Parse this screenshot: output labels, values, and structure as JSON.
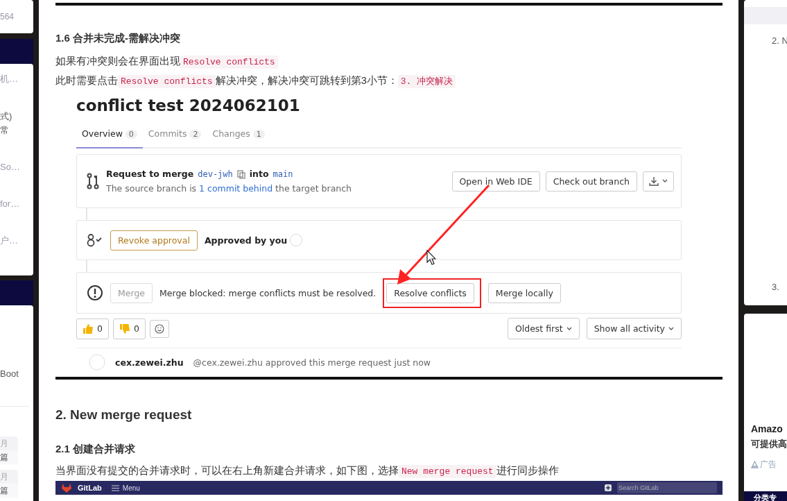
{
  "left_sidebar": {
    "top_card_text": "564",
    "recent_items": [
      "机…",
      "式)",
      "常",
      "So…",
      "for…",
      "户…"
    ],
    "second_card_items": [
      "Boot"
    ],
    "archive_chips": [
      {
        "month": "月",
        "count": "篇"
      },
      {
        "month": "月",
        "count": "篇"
      }
    ]
  },
  "article": {
    "section_heading": "1.6 合并未完成-需解决冲突",
    "paragraphs": [
      [
        {
          "kind": "text",
          "text": "如果有冲突则会在界面出现"
        },
        {
          "kind": "code",
          "text": "Resolve conflicts"
        }
      ],
      [
        {
          "kind": "text",
          "text": "此时需要点击"
        },
        {
          "kind": "code",
          "text": "Resolve conflicts"
        },
        {
          "kind": "text",
          "text": "解决冲突，解决冲突可跳转到第3小节："
        },
        {
          "kind": "code",
          "text": "3. 冲突解决"
        }
      ]
    ],
    "screenshot": {
      "title": "conflict test 2024062101",
      "tabs": [
        {
          "label": "Overview",
          "count": "0",
          "selected": true
        },
        {
          "label": "Commits",
          "count": "2",
          "selected": false
        },
        {
          "label": "Changes",
          "count": "1",
          "selected": false
        }
      ],
      "merge_info": {
        "prefix": "Request to merge",
        "source_branch": "dev-jwh",
        "joiner": "into",
        "target_branch": "main",
        "status_before": "The source branch is ",
        "status_link": "1 commit behind",
        "status_after": " the target branch",
        "buttons": [
          "Open in Web IDE",
          "Check out branch"
        ]
      },
      "approval": {
        "button": "Revoke approval",
        "status": "Approved by you"
      },
      "merge_widget": {
        "merge_button": {
          "label": "Merge",
          "disabled": true
        },
        "message": "Merge blocked: merge conflicts must be resolved.",
        "actions": [
          {
            "label": "Resolve conflicts",
            "highlighted": true
          },
          {
            "label": "Merge locally",
            "highlighted": false
          }
        ]
      },
      "reactions": [
        {
          "kind": "thumbs_up",
          "count": "0"
        },
        {
          "kind": "thumbs_down",
          "count": "0"
        }
      ],
      "sort_buttons": [
        "Oldest first",
        "Show all activity"
      ],
      "activity": {
        "author": "cex.zewei.zhu",
        "text": "@cex.zewei.zhu approved this merge request just now"
      }
    },
    "heading_2": "2. New merge request",
    "heading_3": "2.1 创建合并请求",
    "paragraph_3": [
      {
        "kind": "text",
        "text": "当界面没有提交的合并请求时，可以在右上角新建合并请求，如下图，选择"
      },
      {
        "kind": "code",
        "text": "New merge request"
      },
      {
        "kind": "text",
        "text": "进行同步操作"
      }
    ],
    "screenshot_2": {
      "brand": "GitLab",
      "menu": "Menu",
      "search_placeholder": "Search GitLab"
    }
  },
  "right_sidebar": {
    "toc_items": [
      "2. N",
      "3."
    ],
    "ad": {
      "title": "Amazo",
      "text": "可提供高",
      "label": "广告"
    },
    "bottom_header": "分类专"
  }
}
